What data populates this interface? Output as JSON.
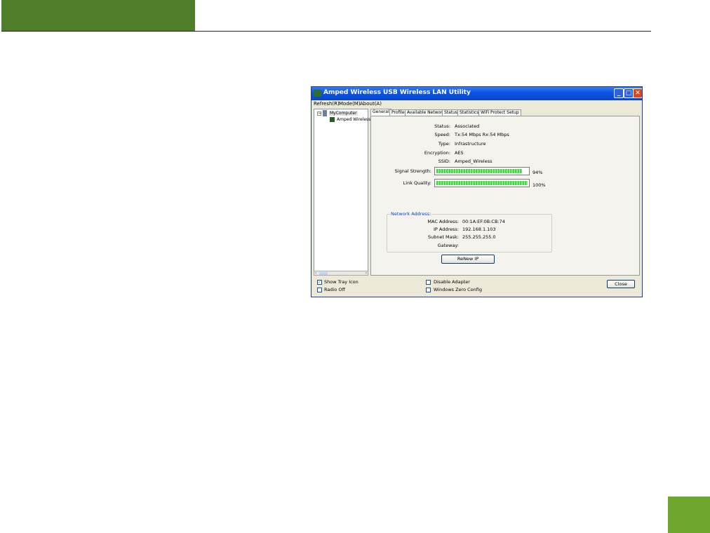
{
  "window": {
    "title": "Amped Wireless USB Wireless LAN Utility",
    "controls": {
      "minimize": "_",
      "maximize": "□",
      "close": "✕"
    }
  },
  "menu": [
    "Refresh(R)",
    "Mode(M)",
    "About(A)"
  ],
  "tree": {
    "expander": "−",
    "root": "MyComputer",
    "child": "Amped Wireless"
  },
  "scroll": {
    "left": "‹",
    "right": "›"
  },
  "tabs": [
    "General",
    "Profile",
    "Available Network",
    "Status",
    "Statistics",
    "WiFi Protect Setup"
  ],
  "general": {
    "status_label": "Status:",
    "status": "Associated",
    "speed_label": "Speed:",
    "speed": "Tx:54 Mbps Rx:54 Mbps",
    "type_label": "Type:",
    "type": "Infrastructure",
    "encryption_label": "Encryption:",
    "encryption": "AES",
    "ssid_label": "SSID:",
    "ssid": "Amped_Wireless",
    "signal_label": "Signal Strength:",
    "signal_text": "94%",
    "signal_value": 0.94,
    "quality_label": "Link Quality:",
    "quality_text": "100%",
    "quality_value": 1.0
  },
  "network": {
    "title": "Network Address:",
    "mac_label": "MAC Address:",
    "mac": "00:1A:EF:0B:CB:74",
    "ip_label": "IP Address:",
    "ip": "192.168.1.103",
    "mask_label": "Subnet Mask:",
    "mask": "255.255.255.0",
    "gateway_label": "Gateway:",
    "gateway": ""
  },
  "renew_button": "ReNew IP",
  "footer": {
    "show_tray_icon": "Show Tray Icon",
    "show_tray_checked": true,
    "radio_off": "Radio Off",
    "radio_off_checked": false,
    "disable_adapter": "Disable Adapter",
    "disable_adapter_checked": false,
    "windows_zero_config": "Windows Zero Config",
    "windows_zero_config_checked": false,
    "check_mark": "✓",
    "close_button": "Close"
  },
  "colors": {
    "header_block": "#4f7f2b",
    "corner_block": "#6ea62e",
    "titlebar": "#0b56e6",
    "meter_green": "#3fd83f"
  }
}
